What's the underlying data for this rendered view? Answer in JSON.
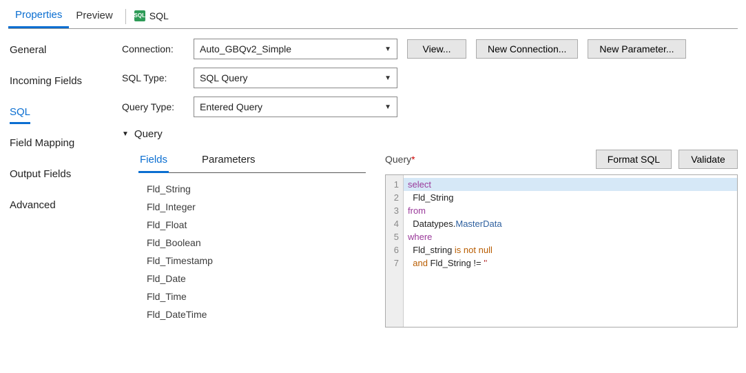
{
  "topTabs": {
    "properties": "Properties",
    "preview": "Preview",
    "sql": "SQL",
    "sql_icon_text": "SQL"
  },
  "sideTabs": {
    "general": "General",
    "incoming": "Incoming Fields",
    "sql": "SQL",
    "mapping": "Field Mapping",
    "output": "Output Fields",
    "advanced": "Advanced"
  },
  "form": {
    "connection_label": "Connection:",
    "connection_value": "Auto_GBQv2_Simple",
    "sqltype_label": "SQL Type:",
    "sqltype_value": "SQL Query",
    "querytype_label": "Query Type:",
    "querytype_value": "Entered Query"
  },
  "buttons": {
    "view": "View...",
    "newconn": "New Connection...",
    "newparam": "New Parameter...",
    "formatsql": "Format SQL",
    "validate": "Validate"
  },
  "querySection": {
    "header": "Query",
    "tab_fields": "Fields",
    "tab_params": "Parameters",
    "query_label": "Query"
  },
  "fields": {
    "f0": "Fld_String",
    "f1": "Fld_Integer",
    "f2": "Fld_Float",
    "f3": "Fld_Boolean",
    "f4": "Fld_Timestamp",
    "f5": "Fld_Date",
    "f6": "Fld_Time",
    "f7": "Fld_DateTime"
  },
  "sql": {
    "l1_kw": "select",
    "l2": "  Fld_String",
    "l3_kw": "from",
    "l4a": "  Datatypes.",
    "l4b": "MasterData",
    "l5_kw": "where",
    "l6a": "  Fld_string ",
    "l6b": "is not null",
    "l7a": "  ",
    "l7b": "and",
    "l7c": " Fld_String != ",
    "l7d": "''"
  },
  "lineNums": {
    "n1": "1",
    "n2": "2",
    "n3": "3",
    "n4": "4",
    "n5": "5",
    "n6": "6",
    "n7": "7"
  }
}
